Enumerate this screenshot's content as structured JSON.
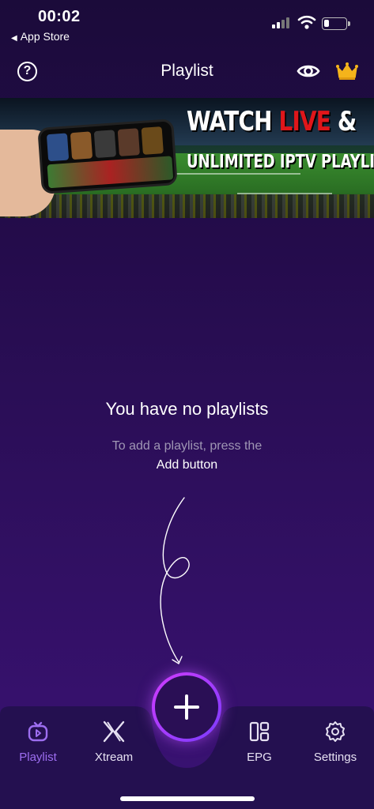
{
  "status_bar": {
    "time": "00:02",
    "back_label": "App Store"
  },
  "header": {
    "title": "Playlist"
  },
  "banner": {
    "line1_a": "WATCH ",
    "line1_live": "LIVE",
    "line1_b": " &",
    "line2": "UNLIMITED IPTV PLAYLIST"
  },
  "empty_state": {
    "title": "You have no playlists",
    "hint_line1": "To add a playlist, press the",
    "hint_line2": "Add button"
  },
  "tabs": [
    {
      "label": "Playlist",
      "icon": "play-tv-icon",
      "active": true
    },
    {
      "label": "Xtream",
      "icon": "x-logo-icon",
      "active": false
    },
    {
      "label": "EPG",
      "icon": "grid-icon",
      "active": false
    },
    {
      "label": "Settings",
      "icon": "gear-icon",
      "active": false
    }
  ],
  "colors": {
    "accent": "#9d6ef0",
    "live_red": "#e0161a",
    "bg_top": "#1b0b3a",
    "bg_bottom": "#3a1274"
  }
}
